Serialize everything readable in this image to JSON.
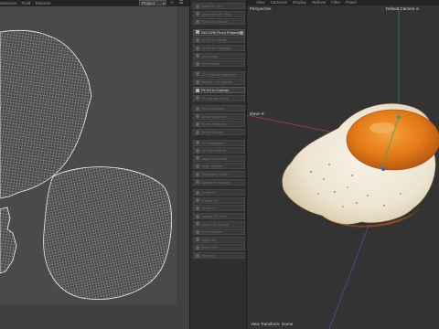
{
  "uv_editor": {
    "menu": [
      "Selection",
      "Field",
      "Textures"
    ],
    "project_select": "Project",
    "tool_icons": [
      "⊹",
      "☰"
    ]
  },
  "palette": {
    "buttons": [
      {
        "label": "Load UV Set",
        "active": false
      },
      {
        "label": "Unstretch UV Map",
        "active": false
      },
      {
        "label": "Pack UV Islands",
        "active": false
      },
      {
        "label": "Set UVW From Projection",
        "active": true
      },
      {
        "label": "UV Relax Mode",
        "active": false
      },
      {
        "label": "UV Relax Settings",
        "active": false
      },
      {
        "label": "UV Unfold",
        "active": false
      },
      {
        "label": "UV Unwrap",
        "active": false
      },
      {
        "label": "UV Optimal Mapping",
        "active": false
      },
      {
        "label": "Realign UV Islands",
        "active": false
      },
      {
        "label": "Fit UV to Canvas",
        "active": true
      },
      {
        "label": "Fit Canvas to UV",
        "active": false
      },
      {
        "label": "Select Islands",
        "active": false
      },
      {
        "label": "Grow Selection",
        "active": false
      },
      {
        "label": "Shrink Selection",
        "active": false
      },
      {
        "label": "Select Border",
        "active": false
      },
      {
        "label": "UV Transform",
        "active": false
      },
      {
        "label": "UV Flip Vertical",
        "active": false
      },
      {
        "label": "Align Horizontal",
        "active": false
      },
      {
        "label": "Align Vertical",
        "active": false
      },
      {
        "label": "Straighten Grids",
        "active": false
      },
      {
        "label": "Distribute Spacing",
        "active": false
      },
      {
        "label": "Scale UV",
        "active": false
      },
      {
        "label": "Rotate UV",
        "active": false
      },
      {
        "label": "Scale UV",
        "active": false
      },
      {
        "label": "Layout UV Grid",
        "active": false
      },
      {
        "label": "Stack UV Islands",
        "active": false
      },
      {
        "label": "Pin Selection",
        "active": false
      },
      {
        "label": "Unpin All",
        "active": false
      },
      {
        "label": "Weld UVs",
        "active": false
      },
      {
        "label": "Settings",
        "active": false
      }
    ]
  },
  "viewport": {
    "menu": [
      "View",
      "Cameras",
      "Display",
      "Options",
      "Filter",
      "Panel"
    ],
    "view_name": "Perspective",
    "camera_label": "Default Camera ⊙",
    "tool_label": "Move ✛",
    "footer": "View Transform: Scene"
  },
  "colors": {
    "uv_wire": "#e8e8e8",
    "yolk": "#e87b1a",
    "egg_white": "#f1ece0",
    "axis_x": "#c84040",
    "axis_y": "#3aa07a",
    "axis_z": "#3a5fc8"
  }
}
